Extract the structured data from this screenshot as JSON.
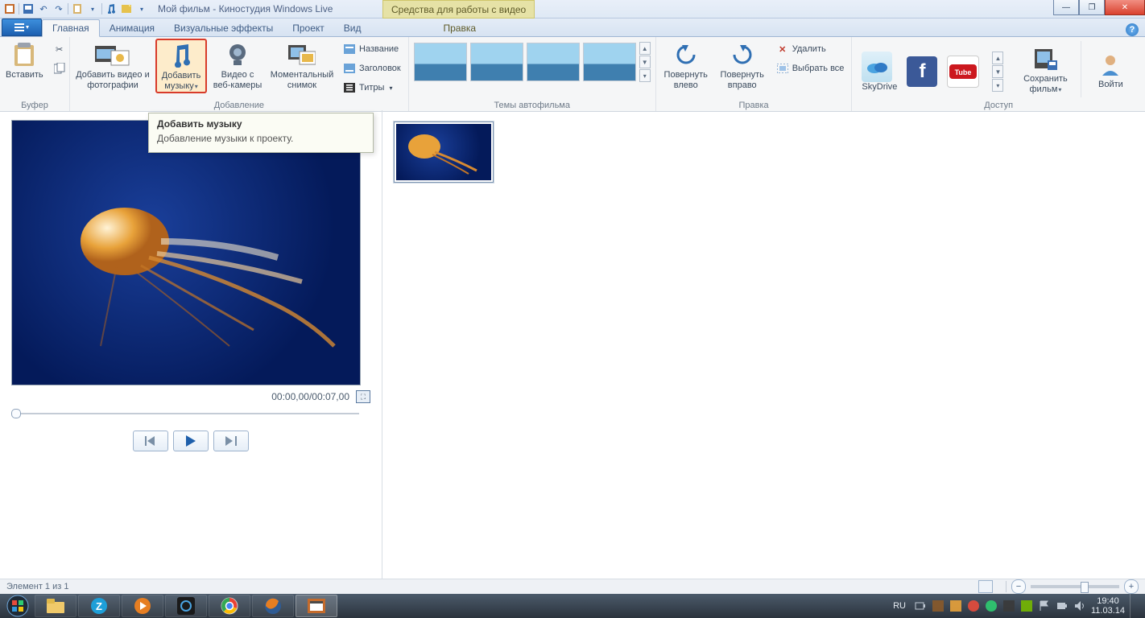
{
  "titlebar": {
    "app_title": "Мой фильм - Киностудия Windows Live",
    "contextual_tab": "Средства для работы с видео"
  },
  "tabs": {
    "main": "Главная",
    "animation": "Анимация",
    "effects": "Визуальные эффекты",
    "project": "Проект",
    "view": "Вид",
    "edit": "Правка"
  },
  "ribbon": {
    "clipboard": {
      "paste": "Вставить",
      "group": "Буфер"
    },
    "add": {
      "videos_photos": "Добавить видео и фотографии",
      "music": "Добавить музыку",
      "webcam": "Видео с веб-камеры",
      "snapshot": "Моментальный снимок",
      "title": "Название",
      "caption": "Заголовок",
      "credits": "Титры",
      "group": "Добавление"
    },
    "themes": {
      "group": "Темы автофильма"
    },
    "editing": {
      "rotate_left": "Повернуть влево",
      "rotate_right": "Повернуть вправо",
      "delete": "Удалить",
      "select_all": "Выбрать все",
      "group": "Правка"
    },
    "share": {
      "skydrive": "SkyDrive",
      "save_movie": "Сохранить фильм",
      "sign_in": "Войти",
      "group": "Доступ"
    }
  },
  "tooltip": {
    "title": "Добавить музыку",
    "body": "Добавление музыки к проекту."
  },
  "preview": {
    "timecode": "00:00,00/00:07,00"
  },
  "status": {
    "element": "Элемент 1 из 1"
  },
  "taskbar": {
    "lang": "RU",
    "time": "19:40",
    "date": "11.03.14"
  }
}
